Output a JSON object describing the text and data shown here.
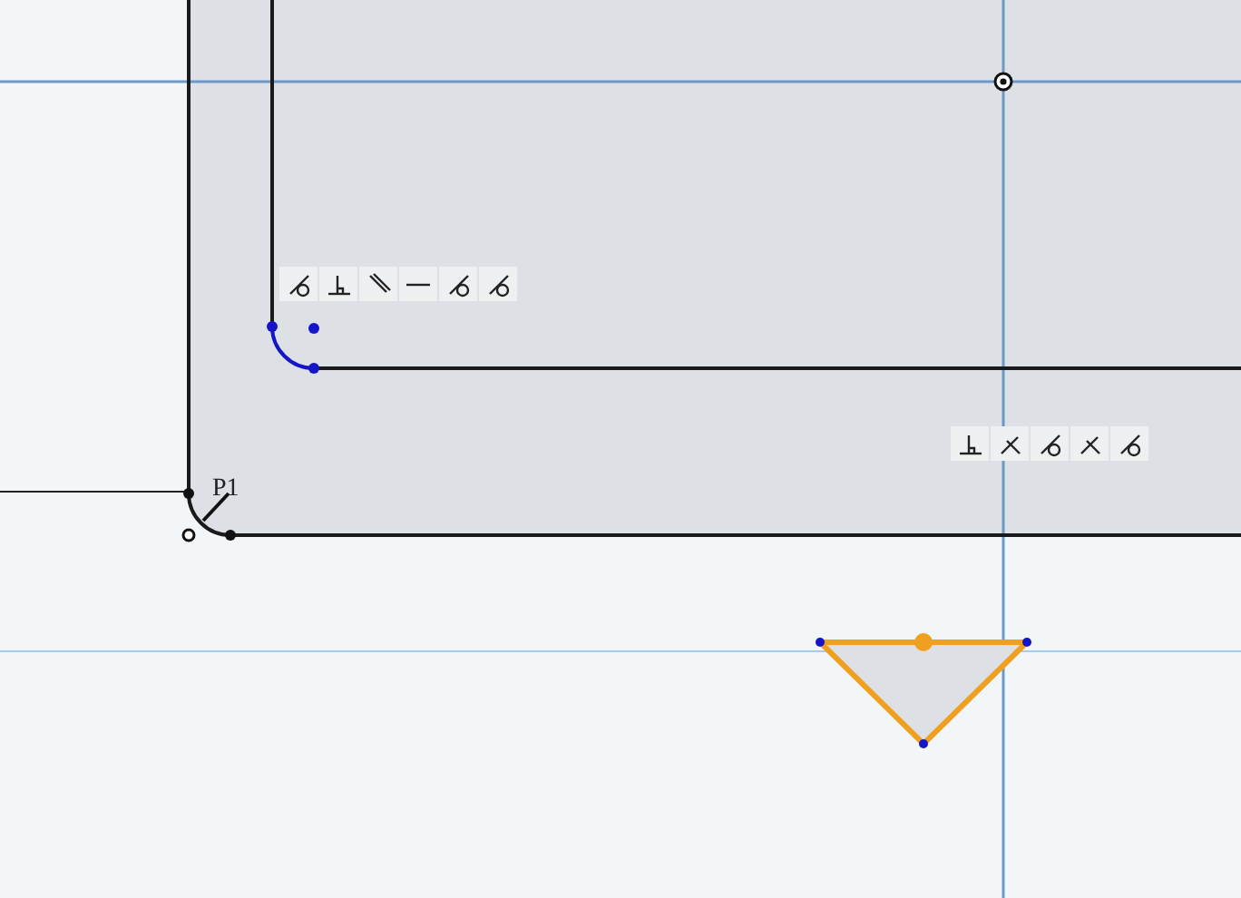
{
  "sketch": {
    "point_label": "P1",
    "constraint_groups": [
      {
        "icons": [
          {
            "kind": "tangent"
          },
          {
            "kind": "perpendicular"
          },
          {
            "kind": "parallel"
          },
          {
            "kind": "horizontal"
          },
          {
            "kind": "tangent"
          },
          {
            "kind": "tangent"
          }
        ]
      },
      {
        "icons": [
          {
            "kind": "perpendicular"
          },
          {
            "kind": "angle"
          },
          {
            "kind": "tangent"
          },
          {
            "kind": "angle"
          },
          {
            "kind": "tangent"
          }
        ]
      }
    ]
  }
}
